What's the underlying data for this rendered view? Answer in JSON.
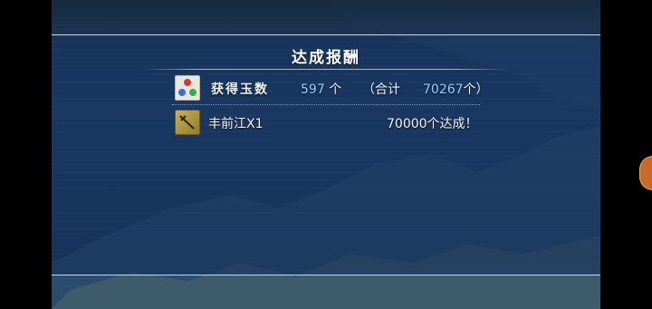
{
  "reward_panel": {
    "title": "达成报酬",
    "jade_row": {
      "icon": "jade-icon",
      "label": "获得玉数",
      "count": "597",
      "unit": "个",
      "total_label": "（合计",
      "total_value": "70267",
      "total_suffix": "个）"
    },
    "item_row": {
      "icon": "sword-icon",
      "item_name": "丰前江X1",
      "achievement": "70000个达成！"
    }
  },
  "colors": {
    "panel_bg": "#1f4068",
    "accent_number": "#9fc6ff",
    "side_button": "#c76a2a"
  }
}
